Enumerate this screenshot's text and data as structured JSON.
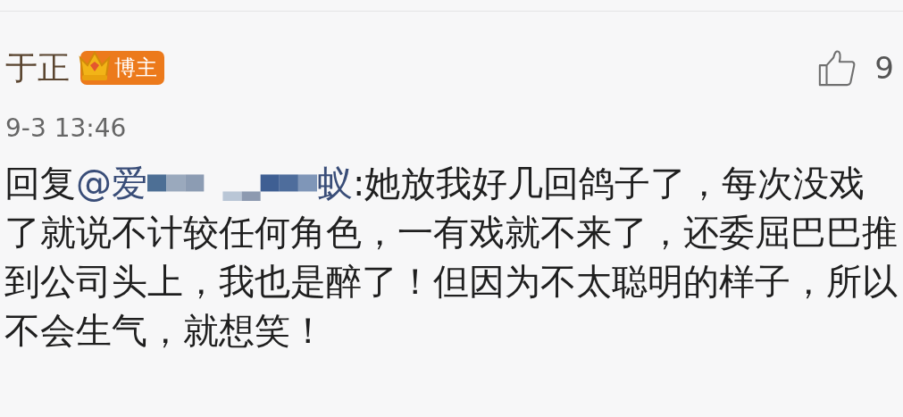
{
  "comment": {
    "author": "于正",
    "badge": "博主",
    "time": "9-3 13:46",
    "likes": "9",
    "reply_prefix": "回复",
    "mention_start": "@爱",
    "mention_end": "蚁",
    "body": ":她放我好几回鸽子了，每次没戏了就说不计较任何角色，一有戏就不来了，还委屈巴巴推到公司头上，我也是醉了！但因为不太聪明的样子，所以不会生气，就想笑！"
  }
}
